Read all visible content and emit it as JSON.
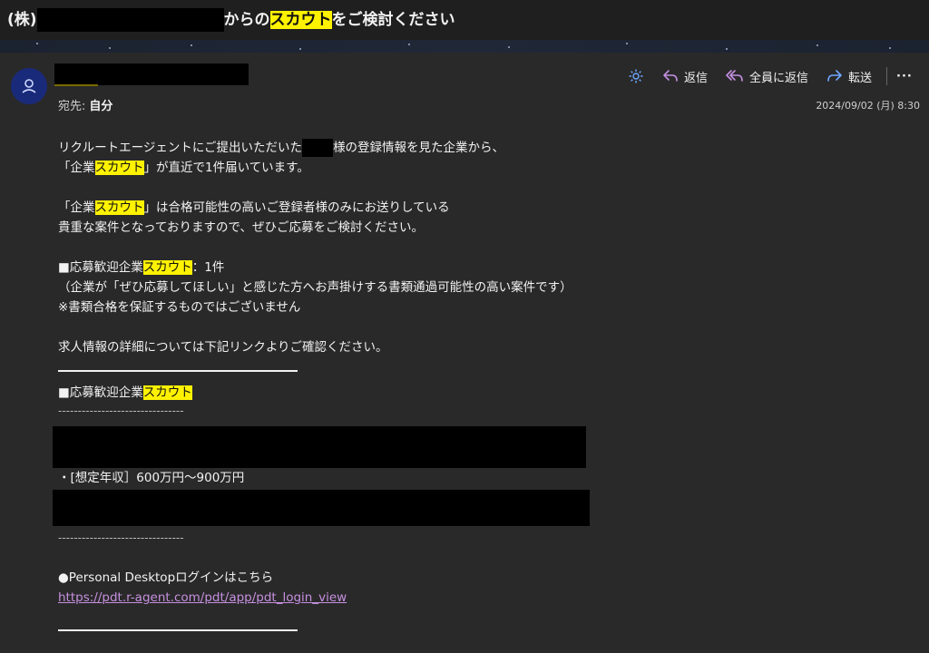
{
  "subject": {
    "prefix": "(株)",
    "mid": "からの",
    "highlight": "スカウト",
    "suffix": "をご検討ください"
  },
  "header": {
    "to_label": "宛先:",
    "to_value": "自分",
    "date": "2024/09/02 (月) 8:30"
  },
  "toolbar": {
    "reply": "返信",
    "reply_all": "全員に返信",
    "forward": "転送",
    "more": "···"
  },
  "body": {
    "p1_a": "リクルートエージェントにご提出いただいた",
    "p1_b": "様の登録情報を見た企業から、",
    "p2_a": "「企業",
    "p2_hl": "スカウト",
    "p2_b": "」が直近で1件届いています。",
    "p3_a": "「企業",
    "p3_hl": "スカウト",
    "p3_b": "」は合格可能性の高いご登録者様のみにお送りしている",
    "p4": "貴重な案件となっておりますので、ぜひご応募をご検討ください。",
    "p5_a": "■応募歓迎企業",
    "p5_hl": "スカウト",
    "p5_b": "：1件",
    "p6": "（企業が「ぜひ応募してほしい」と感じた方へお声掛けする書類通過可能性の高い案件です）",
    "p7": "※書類合格を保証するものではございません",
    "p8": "求人情報の詳細については下記リンクよりご確認ください。",
    "sec_a": "■応募歓迎企業",
    "sec_hl": "スカウト",
    "dashes": "--------------------------------",
    "salary": "・[想定年収］600万円〜900万円",
    "login_label": "●Personal Desktopログインはこちら",
    "login_url": "https://pdt.r-agent.com/pdt/app/pdt_login_view"
  }
}
